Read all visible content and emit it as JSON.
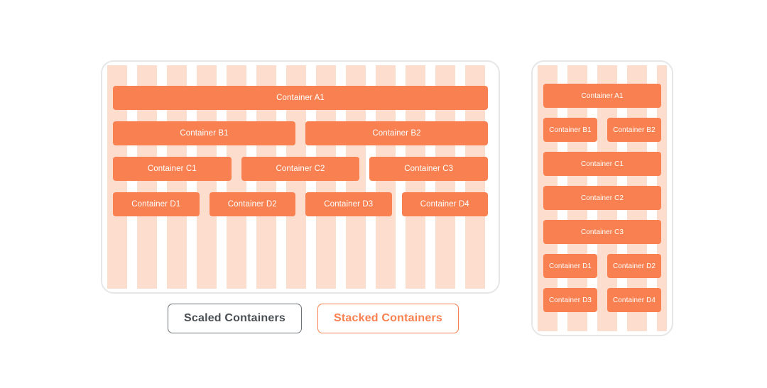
{
  "colors": {
    "container_fill": "#f98050",
    "container_text": "#ffffff",
    "stripe_peach": "#fcddce",
    "stripe_white": "#ffffff",
    "panel_border": "#e4e6e8",
    "legend_scaled_border": "#6e7377",
    "legend_scaled_text": "#4a4f54",
    "legend_stacked_border": "#f98050",
    "legend_stacked_text": "#f98050"
  },
  "scaled_panel": {
    "rows": [
      {
        "boxes": [
          {
            "label": "Container A1",
            "flex": 4
          }
        ]
      },
      {
        "boxes": [
          {
            "label": "Container B1",
            "flex": 1
          },
          {
            "label": "Container B2",
            "flex": 1
          }
        ]
      },
      {
        "boxes": [
          {
            "label": "Container C1",
            "flex": 1
          },
          {
            "label": "Container C2",
            "flex": 1
          },
          {
            "label": "Container C3",
            "flex": 1
          }
        ]
      },
      {
        "boxes": [
          {
            "label": "Container D1",
            "flex": 1
          },
          {
            "label": "Container D2",
            "flex": 1
          },
          {
            "label": "Container D3",
            "flex": 1
          },
          {
            "label": "Container D4",
            "flex": 1
          }
        ]
      }
    ]
  },
  "stacked_panel": {
    "rows": [
      {
        "boxes": [
          {
            "label": "Container A1",
            "flex": 2
          }
        ]
      },
      {
        "boxes": [
          {
            "label": "Container B1",
            "flex": 1
          },
          {
            "label": "Container B2",
            "flex": 1
          }
        ]
      },
      {
        "boxes": [
          {
            "label": "Container C1",
            "flex": 2
          }
        ]
      },
      {
        "boxes": [
          {
            "label": "Container C2",
            "flex": 2
          }
        ]
      },
      {
        "boxes": [
          {
            "label": "Container C3",
            "flex": 2
          }
        ]
      },
      {
        "boxes": [
          {
            "label": "Container D1",
            "flex": 1
          },
          {
            "label": "Container D2",
            "flex": 1
          }
        ]
      },
      {
        "boxes": [
          {
            "label": "Container D3",
            "flex": 1
          },
          {
            "label": "Container D4",
            "flex": 1
          }
        ]
      }
    ]
  },
  "legend": {
    "scaled_label": "Scaled Containers",
    "stacked_label": "Stacked Containers"
  }
}
